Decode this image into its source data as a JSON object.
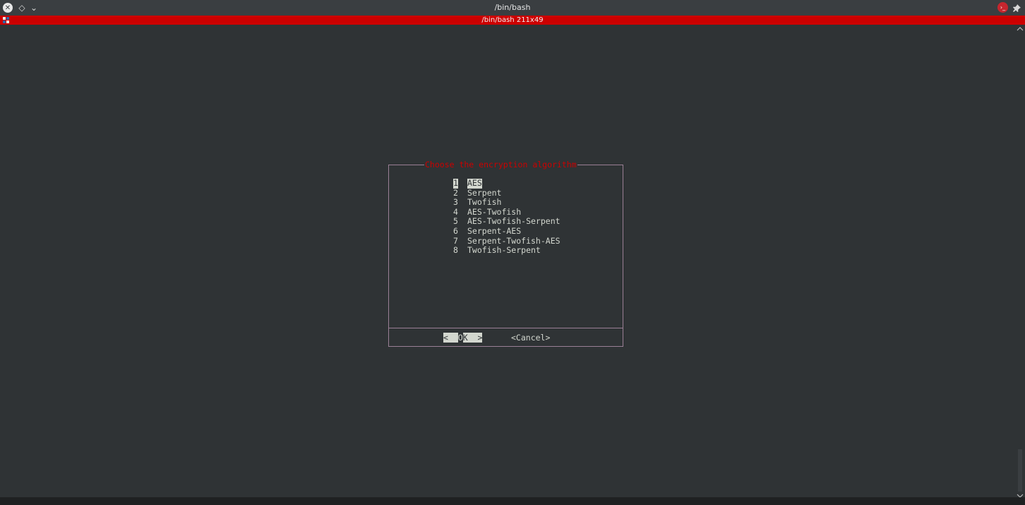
{
  "window": {
    "title": "/bin/bash",
    "close_glyph": "✕",
    "sticky_glyph": "◇",
    "more_glyph": "⌄",
    "app_glyph": "›_",
    "pin_glyph": "📌"
  },
  "tab": {
    "title": "/bin/bash 211x49"
  },
  "dialog": {
    "title": "Choose the encryption algorithm",
    "items": [
      {
        "num": "1",
        "label": "AES",
        "selected": true
      },
      {
        "num": "2",
        "label": "Serpent"
      },
      {
        "num": "3",
        "label": "Twofish"
      },
      {
        "num": "4",
        "label": "AES-Twofish"
      },
      {
        "num": "5",
        "label": "AES-Twofish-Serpent"
      },
      {
        "num": "6",
        "label": "Serpent-AES"
      },
      {
        "num": "7",
        "label": "Serpent-Twofish-AES"
      },
      {
        "num": "8",
        "label": "Twofish-Serpent"
      }
    ],
    "ok": {
      "left": "<  ",
      "hotkey": "O",
      "right": "K  >"
    },
    "cancel_label": "<Cancel>"
  },
  "scroll": {
    "up_glyph": "▲",
    "down_glyph": "▼"
  },
  "colors": {
    "title_red": "#cc0000",
    "tab_red": "#cc0000",
    "terminal_bg": "#2f3335",
    "text": "#d3d7cf",
    "dialog_border": "#9a7f95"
  }
}
